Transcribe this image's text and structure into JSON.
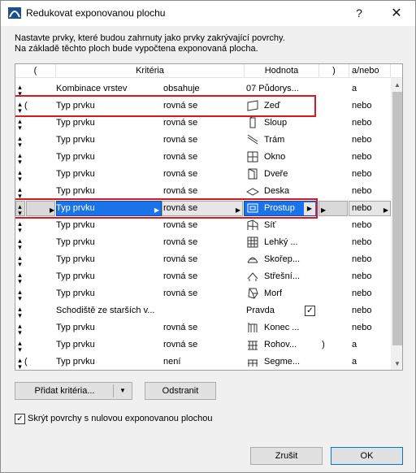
{
  "window": {
    "title": "Redukovat exponovanou plochu",
    "help_label": "?",
    "close_label": "✕"
  },
  "description": {
    "line1": "Nastavte prvky, které budou zahrnuty jako prvky zakrývající povrchy.",
    "line2": "Na základě těchto ploch bude vypočtena exponovaná plocha."
  },
  "table": {
    "headers": {
      "open": "(",
      "criteria": "Kritéria",
      "value": "Hodnota",
      "close": ")",
      "andor": "a/nebo"
    },
    "selected_row_index": 7,
    "highlighted_rows": [
      1,
      7
    ],
    "rows": [
      {
        "open": "",
        "criterion": "Kombinace vrstev",
        "operator": "obsahuje",
        "icon": "",
        "value": "07 Půdorys...",
        "close": "",
        "andor": "a"
      },
      {
        "open": "(",
        "criterion": "Typ prvku",
        "operator": "rovná se",
        "icon": "wall-icon",
        "value": "Zeď",
        "close": "",
        "andor": "nebo"
      },
      {
        "open": "",
        "criterion": "Typ prvku",
        "operator": "rovná se",
        "icon": "column-icon",
        "value": "Sloup",
        "close": "",
        "andor": "nebo"
      },
      {
        "open": "",
        "criterion": "Typ prvku",
        "operator": "rovná se",
        "icon": "beam-icon",
        "value": "Trám",
        "close": "",
        "andor": "nebo"
      },
      {
        "open": "",
        "criterion": "Typ prvku",
        "operator": "rovná se",
        "icon": "window-icon",
        "value": "Okno",
        "close": "",
        "andor": "nebo"
      },
      {
        "open": "",
        "criterion": "Typ prvku",
        "operator": "rovná se",
        "icon": "door-icon",
        "value": "Dveře",
        "close": "",
        "andor": "nebo"
      },
      {
        "open": "",
        "criterion": "Typ prvku",
        "operator": "rovná se",
        "icon": "slab-icon",
        "value": "Deska",
        "close": "",
        "andor": "nebo"
      },
      {
        "open": "",
        "criterion": "Typ prvku",
        "operator": "rovná se",
        "icon": "opening-icon",
        "value": "Prostup",
        "close": "",
        "andor": "nebo"
      },
      {
        "open": "",
        "criterion": "Typ prvku",
        "operator": "rovná se",
        "icon": "mesh-icon",
        "value": "Síť",
        "close": "",
        "andor": "nebo"
      },
      {
        "open": "",
        "criterion": "Typ prvku",
        "operator": "rovná se",
        "icon": "curtain-wall-icon",
        "value": "Lehký ...",
        "close": "",
        "andor": "nebo"
      },
      {
        "open": "",
        "criterion": "Typ prvku",
        "operator": "rovná se",
        "icon": "shell-icon",
        "value": "Skořep...",
        "close": "",
        "andor": "nebo"
      },
      {
        "open": "",
        "criterion": "Typ prvku",
        "operator": "rovná se",
        "icon": "roof-icon",
        "value": "Střešní...",
        "close": "",
        "andor": "nebo"
      },
      {
        "open": "",
        "criterion": "Typ prvku",
        "operator": "rovná se",
        "icon": "morph-icon",
        "value": "Morf",
        "close": "",
        "andor": "nebo"
      },
      {
        "open": "",
        "criterion": "Schodiště ze starších v...",
        "operator": "",
        "icon": "",
        "value": "Pravda",
        "checked": true,
        "close": "",
        "andor": "nebo"
      },
      {
        "open": "",
        "criterion": "Typ prvku",
        "operator": "rovná se",
        "icon": "railing-end-icon",
        "value": "Konec ...",
        "close": "",
        "andor": "nebo"
      },
      {
        "open": "",
        "criterion": "Typ prvku",
        "operator": "rovná se",
        "icon": "railing-post-icon",
        "value": "Rohov...",
        "close": ")",
        "andor": "a"
      },
      {
        "open": "(",
        "criterion": "Typ prvku",
        "operator": "není",
        "icon": "segment-icon",
        "value": "Segme...",
        "close": "",
        "andor": "a"
      }
    ]
  },
  "buttons": {
    "add": "Přidat kritéria...",
    "remove": "Odstranit",
    "cancel": "Zrušit",
    "ok": "OK"
  },
  "hide_option": {
    "label": "Skrýt povrchy s nulovou exponovanou plochou",
    "checked": true
  },
  "colors": {
    "highlight": "#e0151f",
    "selection": "#1a73e8",
    "accent": "#0078d7"
  }
}
